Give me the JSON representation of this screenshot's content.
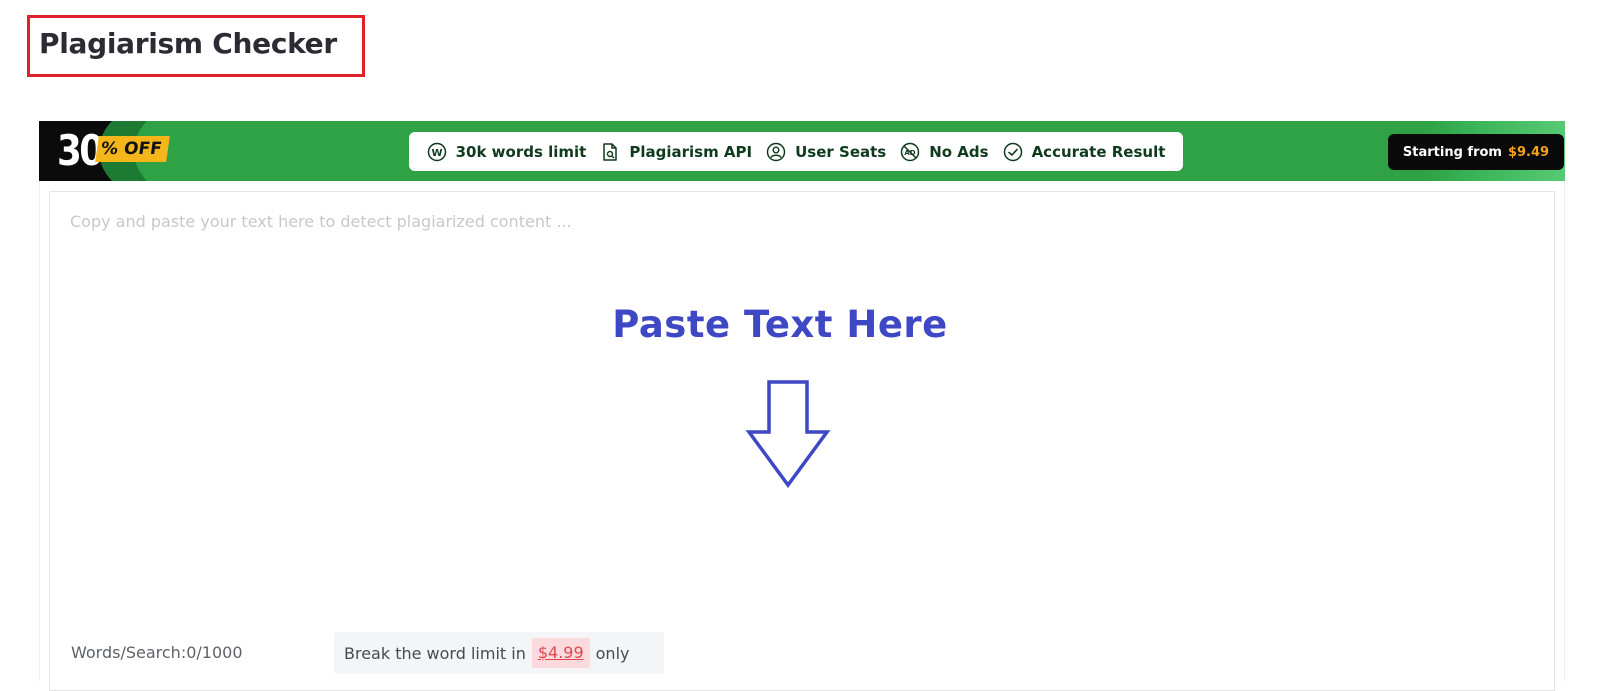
{
  "page": {
    "title": "Plagiarism Checker"
  },
  "promo": {
    "discount_number": "30",
    "discount_suffix": "% OFF",
    "features": [
      {
        "icon": "word-circle-icon",
        "label": "30k words limit"
      },
      {
        "icon": "document-search-icon",
        "label": "Plagiarism API"
      },
      {
        "icon": "user-circle-icon",
        "label": "User Seats"
      },
      {
        "icon": "no-ads-icon",
        "label": "No Ads"
      },
      {
        "icon": "check-circle-icon",
        "label": "Accurate Result"
      }
    ],
    "cta_label": "Starting from",
    "cta_price": "$9.49",
    "close_symbol": "✕",
    "colors": {
      "banner_green": "#2ea245",
      "badge_yellow": "#f4b61a",
      "cta_price": "#f4a31a"
    }
  },
  "editor": {
    "placeholder": "Copy and paste your text here to detect plagiarized content ...",
    "value": "",
    "annotation_text": "Paste Text Here",
    "annotation_color": "#3e47c4"
  },
  "footer": {
    "word_count": "Words/Search:0/1000",
    "upgrade_prefix": "Break the word limit in",
    "upgrade_price": "$4.99",
    "upgrade_suffix": "only"
  },
  "annotation": {
    "highlight_color": "#e0202a"
  }
}
